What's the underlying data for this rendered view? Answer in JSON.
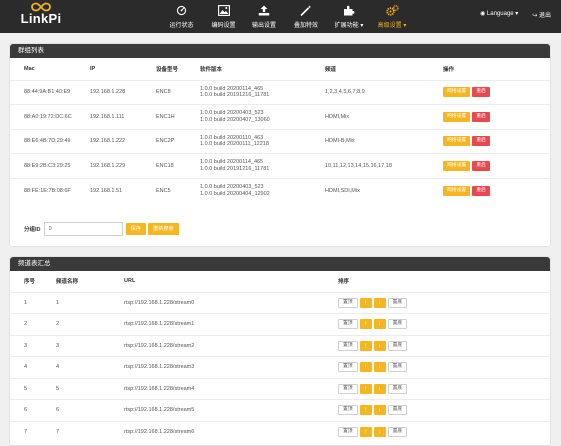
{
  "brand": {
    "name": "LinkPi",
    "icon": "infinity-logo"
  },
  "nav": {
    "items": [
      {
        "label": "运行状态",
        "icon": "dashboard-icon"
      },
      {
        "label": "编码设置",
        "icon": "image-icon"
      },
      {
        "label": "输出设置",
        "icon": "upload-icon"
      },
      {
        "label": "叠加特效",
        "icon": "magic-wand-icon"
      },
      {
        "label": "扩展功能 ▾",
        "icon": "puzzle-icon"
      },
      {
        "label": "高级设置 ▾",
        "icon": "gears-icon"
      }
    ],
    "active_index": 5,
    "language_label": "◉ Language ▾",
    "logout_label": "↪ 退出"
  },
  "group_list": {
    "title": "群组列表",
    "columns": [
      "Mac",
      "IP",
      "设备型号",
      "软件版本",
      "频道",
      "操作"
    ],
    "rows": [
      {
        "mac": "88:44:9A:B1:40:E9",
        "ip": "192.168.1.228",
        "model": "ENC8",
        "sw1": "1.0.0 build 20200114_465",
        "sw2": "1.0.0 build 20191216_11781",
        "channels": "1,2,3,4,5,6,7,8,9"
      },
      {
        "mac": "88:A0:19:72:DC:6C",
        "ip": "192.168.1.111",
        "model": "ENC1H",
        "sw1": "1.0.0 build 20200403_523",
        "sw2": "1.0.0 build 20200407_13060",
        "channels": "HDMI,Mix"
      },
      {
        "mac": "88:E6:4B:7D:29:49",
        "ip": "192.168.1.222",
        "model": "ENC2P",
        "sw1": "1.0.0 build 20200110_463",
        "sw2": "1.0.0 build 20200111_12218",
        "channels": "HDMI-B,Mix"
      },
      {
        "mac": "88:E9:2B:C3:29:25",
        "ip": "192.168.1.229",
        "model": "ENC18",
        "sw1": "1.0.0 build 20200114_465",
        "sw2": "1.0.0 build 20191216_11781",
        "channels": "10,11,12,13,14,15,16,17,18"
      },
      {
        "mac": "88:FE:1E:7B:08:6F",
        "ip": "192.168.1.51",
        "model": "ENC5",
        "sw1": "1.0.0 build 20200403_523",
        "sw2": "1.0.0 build 20200404_12902",
        "channels": "HDMI,SDI,Mix"
      }
    ],
    "net_settings_label": "网络设置",
    "reboot_label": "重启",
    "group_id_label": "分组ID",
    "group_id_value": "0",
    "save_label": "保存",
    "rescan_label": "重新搜索"
  },
  "channel_summary": {
    "title": "频道表汇总",
    "columns": [
      "序号",
      "频道名称",
      "URL",
      "排序"
    ],
    "rows": [
      {
        "no": "1",
        "name": "1",
        "url": "rtsp://192.168.1.228/stream0"
      },
      {
        "no": "2",
        "name": "2",
        "url": "rtsp://192.168.1.228/stream1"
      },
      {
        "no": "3",
        "name": "3",
        "url": "rtsp://192.168.1.228/stream2"
      },
      {
        "no": "4",
        "name": "4",
        "url": "rtsp://192.168.1.228/stream3"
      },
      {
        "no": "5",
        "name": "5",
        "url": "rtsp://192.168.1.228/stream4"
      },
      {
        "no": "6",
        "name": "6",
        "url": "rtsp://192.168.1.228/stream5"
      },
      {
        "no": "7",
        "name": "7",
        "url": "rtsp://192.168.1.228/stream6"
      }
    ],
    "top_label": "置顶",
    "up_label": "↑",
    "down_label": "↓",
    "bottom_label": "置底"
  },
  "colors": {
    "accent": "#f0b020",
    "button_yellow": "#f6b621",
    "button_red": "#e8494e",
    "header_dark": "#3a3a3a",
    "topbar": "#2b2b2b"
  }
}
